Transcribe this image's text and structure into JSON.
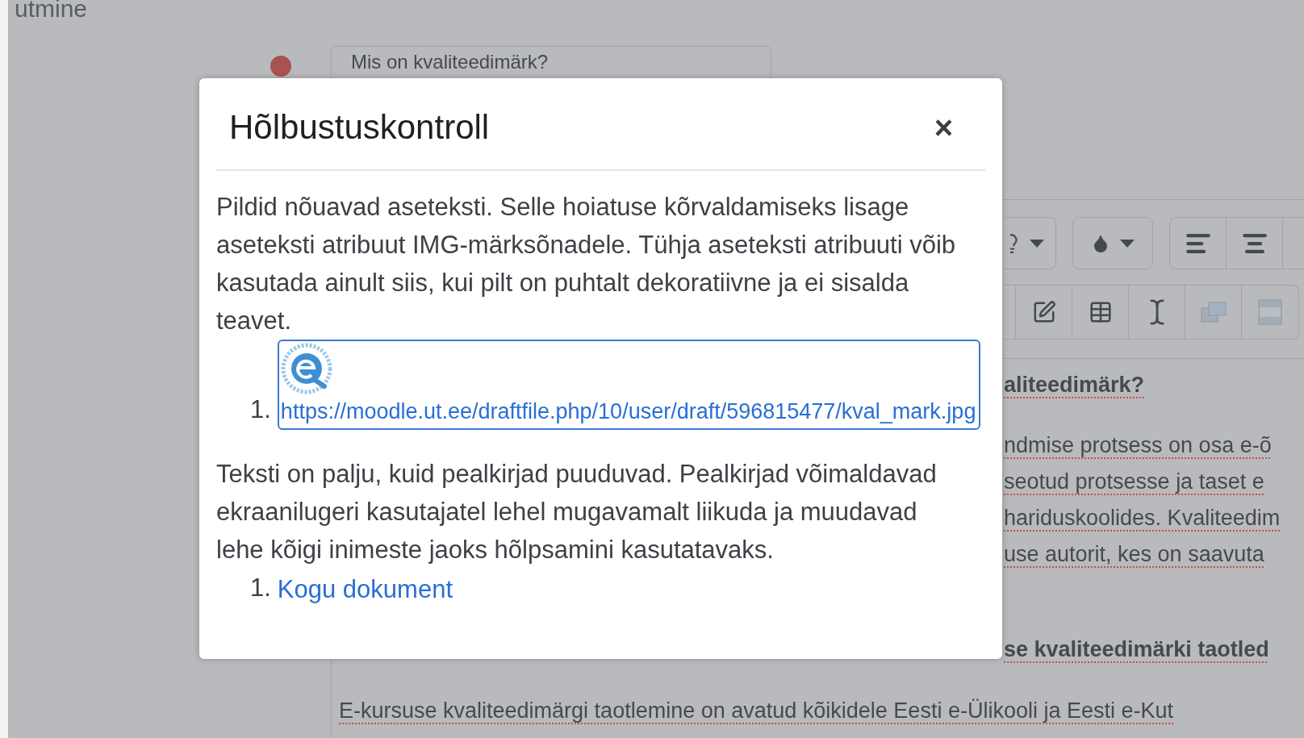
{
  "background": {
    "heading": "utmine",
    "question_field": {
      "value": "Mis on kvaliteedimärk?",
      "error": true
    },
    "editor_lines": [
      {
        "kind": "heading",
        "text": "aliteedimärk?"
      },
      {
        "kind": "paragraph",
        "text": "ndmise protsess on osa e-õ"
      },
      {
        "kind": "paragraph",
        "text": "seotud protsesse ja taset e"
      },
      {
        "kind": "paragraph",
        "text": "hariduskoolides. Kvaliteedim"
      },
      {
        "kind": "paragraph",
        "text": "use autorit, kes on saavuta"
      },
      {
        "kind": "heading",
        "text": "se kvaliteedimärki taotled"
      }
    ],
    "editor_paragraph": "E-kursuse kvaliteedimärgi taotlemine on avatud kõikidele Eesti e-Ülikooli ja Eesti e-Kut"
  },
  "dialog": {
    "title": "Hõlbustuskontroll",
    "close": "×",
    "sections": [
      {
        "text": "Pildid nõuavad aseteksti. Selle hoiatuse kõrvaldamiseks lisage aseteksti atribuut IMG-märksõnadele. Tühja aseteksti atribuuti võib kasutada ainult siis, kui pilt on puhtalt dekoratiivne ja ei sisalda teavet.",
        "items": [
          {
            "number": "1.",
            "kind": "picture",
            "link": "https://moodle.ut.ee/draftfile.php/10/user/draft/596815477/kval_mark.jpg"
          }
        ]
      },
      {
        "text": "Teksti on palju, kuid pealkirjad puuduvad. Pealkirjad võimaldavad ekraanilugeri kasutajatel lehel mugavamalt liikuda ja muudavad lehe kõigi inimeste jaoks hõlpsamini kasutatavaks.",
        "items": [
          {
            "number": "1.",
            "kind": "text",
            "link": "Kogu dokument"
          }
        ]
      }
    ]
  }
}
